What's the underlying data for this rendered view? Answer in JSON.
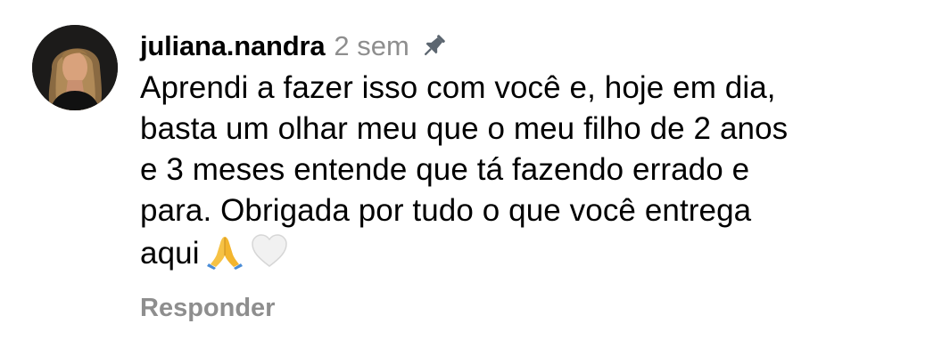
{
  "comment": {
    "username": "juliana.nandra",
    "time": "2 sem",
    "pinned_icon": "pin-icon",
    "text_lines": [
      "Aprendi a fazer isso com você e, hoje em dia,",
      "basta um olhar meu que o meu filho de 2 anos",
      "e 3 meses entende que tá fazendo errado e",
      "para. Obrigada por tudo o que você entrega",
      "aqui"
    ],
    "emojis": [
      "🙏",
      "🤍"
    ],
    "reply_label": "Responder"
  },
  "colors": {
    "text": "#000000",
    "muted": "#8e8e8e",
    "background": "#ffffff"
  }
}
